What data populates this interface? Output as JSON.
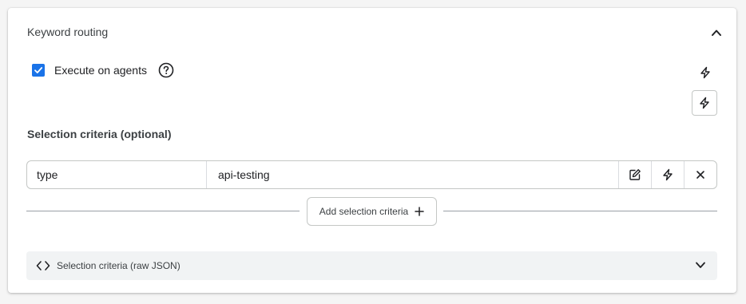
{
  "section": {
    "title": "Keyword routing",
    "collapse_icon": "chevron-up-icon"
  },
  "execute": {
    "label": "Execute on agents",
    "checked": true,
    "help_icon": "help-circle-icon"
  },
  "actions": {
    "top_icon": "bolt-icon",
    "outlined_icon": "bolt-icon"
  },
  "criteria": {
    "heading": "Selection criteria (optional)",
    "rows": [
      {
        "key": "type",
        "value": "api-testing"
      }
    ],
    "row_action_icons": [
      "edit-icon",
      "bolt-icon",
      "close-icon"
    ],
    "add_label": "Add selection criteria",
    "add_icon": "plus-icon"
  },
  "raw_json": {
    "label": "Selection criteria (raw JSON)",
    "icon": "code-icon",
    "expand_icon": "chevron-down-icon"
  },
  "colors": {
    "accent": "#1a73e8",
    "border": "#c4c7c5",
    "panel_bg": "#f1f3f4"
  }
}
